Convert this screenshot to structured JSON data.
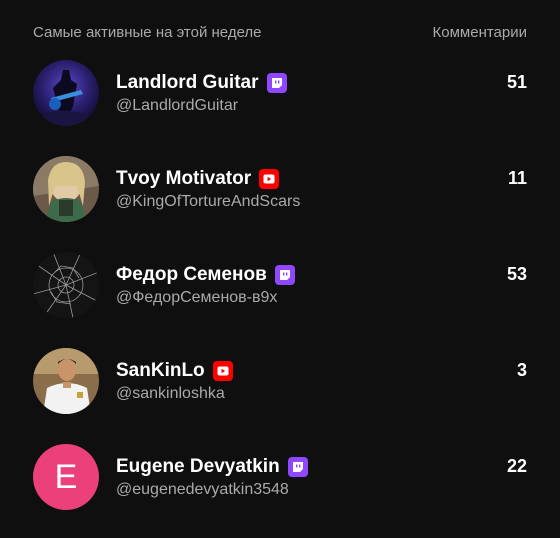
{
  "header": {
    "title": "Самые активные на этой неделе",
    "comments_label": "Комментарии"
  },
  "colors": {
    "background": "#0f0f0f",
    "twitch": "#9147ff",
    "youtube": "#ff0000",
    "letter_avatar": "#ec407a"
  },
  "rows": [
    {
      "name": "Landlord Guitar",
      "handle": "@LandlordGuitar",
      "platform": "twitch",
      "platform_icon": "twitch-icon",
      "count": "51",
      "avatar": "guitarist-avatar"
    },
    {
      "name": "Tvoy Motivator",
      "handle": "@KingOfTortureAndScars",
      "platform": "youtube",
      "platform_icon": "youtube-icon",
      "count": "11",
      "avatar": "anime-character-avatar"
    },
    {
      "name": "Федор Семенов",
      "handle": "@ФедорСеменов-в9х",
      "platform": "twitch",
      "platform_icon": "twitch-icon",
      "count": "53",
      "avatar": "cracked-glass-avatar"
    },
    {
      "name": "SanKinLo",
      "handle": "@sankinloshka",
      "platform": "youtube",
      "platform_icon": "youtube-icon",
      "count": "3",
      "avatar": "football-player-avatar"
    },
    {
      "name": "Eugene Devyatkin",
      "handle": "@eugenedevyatkin3548",
      "platform": "twitch",
      "platform_icon": "twitch-icon",
      "count": "22",
      "avatar_letter": "E"
    }
  ]
}
